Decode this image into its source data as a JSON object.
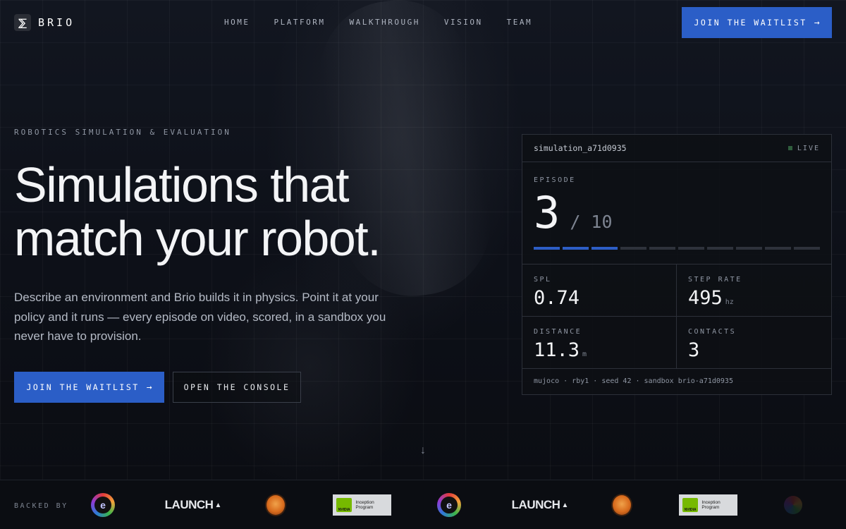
{
  "brand": {
    "name": "BRIO"
  },
  "nav": {
    "links": [
      "HOME",
      "PLATFORM",
      "WALKTHROUGH",
      "VISION",
      "TEAM"
    ],
    "cta_label": "JOIN THE WAITLIST"
  },
  "hero": {
    "eyebrow": "ROBOTICS SIMULATION & EVALUATION",
    "headline_line1": "Simulations that",
    "headline_line2": "match your robot.",
    "subtext": "Describe an environment and Brio builds it in physics. Point it at your policy and it runs — every episode on video, scored, in a sandbox you never have to provision.",
    "primary_cta": "JOIN THE WAITLIST",
    "secondary_cta": "OPEN THE CONSOLE"
  },
  "panel": {
    "sim_id": "simulation_a71d0935",
    "status": "LIVE",
    "episode": {
      "label": "EPISODE",
      "current": "3",
      "total": "/ 10",
      "completed": 3,
      "count": 10
    },
    "metrics": {
      "spl": {
        "label": "SPL",
        "value": "0.74",
        "unit": ""
      },
      "step_rate": {
        "label": "STEP RATE",
        "value": "495",
        "unit": "hz"
      },
      "distance": {
        "label": "DISTANCE",
        "value": "11.3",
        "unit": "m"
      },
      "contacts": {
        "label": "CONTACTS",
        "value": "3",
        "unit": ""
      }
    },
    "footer": "mujoco · rby1 · seed 42 · sandbox brio-a71d0935"
  },
  "backers": {
    "label": "BACKED BY",
    "logos": [
      "e",
      "LAUNCH",
      "badge",
      "NVIDIA Inception Program",
      "e",
      "LAUNCH",
      "badge",
      "NVIDIA Inception Program"
    ],
    "launch_text": "LAUNCH",
    "nvidia_word": "NVIDIA",
    "inception_text": "Inception Program"
  },
  "colors": {
    "accent": "#2b5ec7",
    "background": "#0c0f15",
    "live_dot": "#2f5d3d"
  }
}
